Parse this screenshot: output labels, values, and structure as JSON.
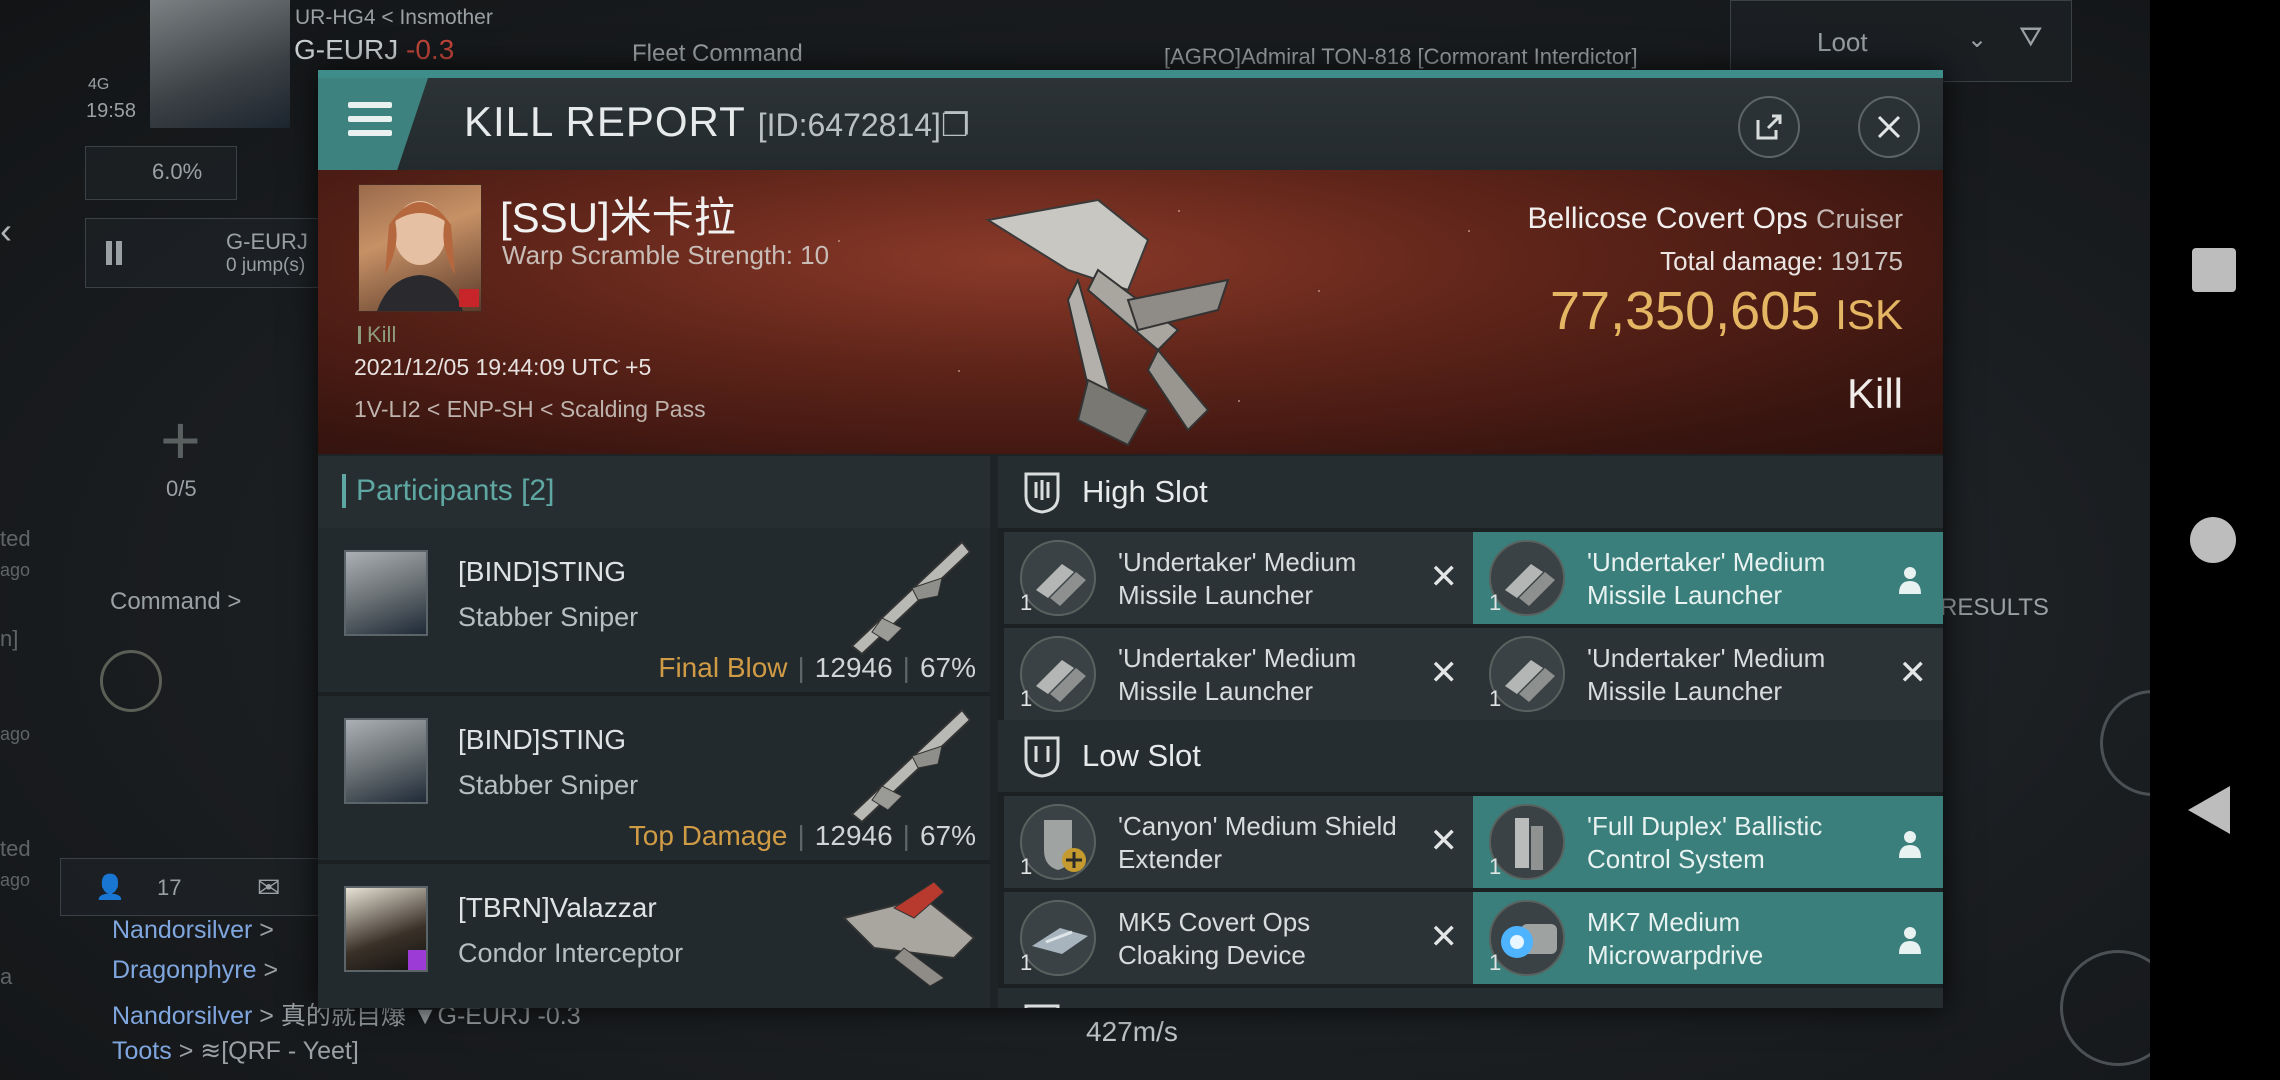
{
  "hud": {
    "pilot_line1": "UR-HG4",
    "pilot_line1b": "Insmother",
    "system": "G-EURJ",
    "security": "-0.3",
    "signal": "4G",
    "time": "19:58",
    "percent": "6.0%",
    "route_system": "G-EURJ",
    "route_jumps": "0 jump(s)",
    "fleet_command": "Fleet Command",
    "ticker": "[AGRO]Admiral TON-818 [Cormorant Interdictor]",
    "loot": "Loot",
    "slots_count": "0/5",
    "command": "Command >",
    "results": "RESULTS",
    "chat_count": "17",
    "chat_lines": [
      {
        "name": "Nandorsilver",
        "rest": ">"
      },
      {
        "name": "Dragonphyre",
        "rest": ">"
      },
      {
        "name": "Nandorsilver",
        "rest": "> 真的就自爆 ▼G-EURJ -0.3"
      },
      {
        "name": "Toots",
        "rest": "> ≋[QRF - Yeet]"
      }
    ],
    "speed": "427m/s",
    "left_snips": [
      "ted",
      "ago",
      "n]",
      "ago",
      "ted",
      "ago",
      "a"
    ]
  },
  "dialog": {
    "title": "KILL REPORT",
    "report_id": "[ID:6472814]",
    "menu_icon": "hamburger-icon",
    "share_icon": "share-icon",
    "close_icon": "close-icon"
  },
  "victim": {
    "name": "[SSU]米卡拉",
    "scramble": "Warp Scramble Strength: 10",
    "kill_label": "Kill",
    "datetime": "2021/12/05 19:44:09 UTC +5",
    "location": "1V-LI2 < ENP-SH < Scalding Pass",
    "ship": "Bellicose Covert Ops",
    "ship_class": "Cruiser",
    "total_damage_label": "Total damage:",
    "total_damage": "19175",
    "isk_value": "77,350,605",
    "isk_unit": "ISK",
    "result": "Kill"
  },
  "participants": {
    "label": "Participants",
    "count": "[2]",
    "rows": [
      {
        "name": "[BIND]STING",
        "ship": "Stabber Sniper",
        "tag": "Final Blow",
        "damage": "12946",
        "percent": "67%"
      },
      {
        "name": "[BIND]STING",
        "ship": "Stabber Sniper",
        "tag": "Top Damage",
        "damage": "12946",
        "percent": "67%"
      },
      {
        "name": "[TBRN]Valazzar",
        "ship": "Condor Interceptor",
        "tag": "",
        "damage": "",
        "percent": ""
      }
    ]
  },
  "slots": {
    "high_label": "High Slot",
    "low_label": "Low Slot",
    "high": [
      {
        "qty": "1",
        "name": "'Undertaker' Medium Missile Launcher",
        "state": "destroyed"
      },
      {
        "qty": "1",
        "name": "'Undertaker' Medium Missile Launcher",
        "state": "dropped"
      },
      {
        "qty": "1",
        "name": "'Undertaker' Medium Missile Launcher",
        "state": "destroyed"
      },
      {
        "qty": "1",
        "name": "'Undertaker' Medium Missile Launcher",
        "state": "destroyed"
      }
    ],
    "low": [
      {
        "qty": "1",
        "name": "'Canyon' Medium Shield Extender",
        "state": "destroyed"
      },
      {
        "qty": "1",
        "name": "'Full Duplex' Ballistic Control System",
        "state": "dropped"
      },
      {
        "qty": "1",
        "name": "MK5 Covert Ops Cloaking Device",
        "state": "destroyed"
      },
      {
        "qty": "1",
        "name": "MK7 Medium Microwarpdrive",
        "state": "dropped"
      }
    ]
  },
  "colors": {
    "accent": "#3e8d8a",
    "isk": "#e4b663",
    "tag": "#d09b45",
    "dropped": "#3a7f7b"
  }
}
